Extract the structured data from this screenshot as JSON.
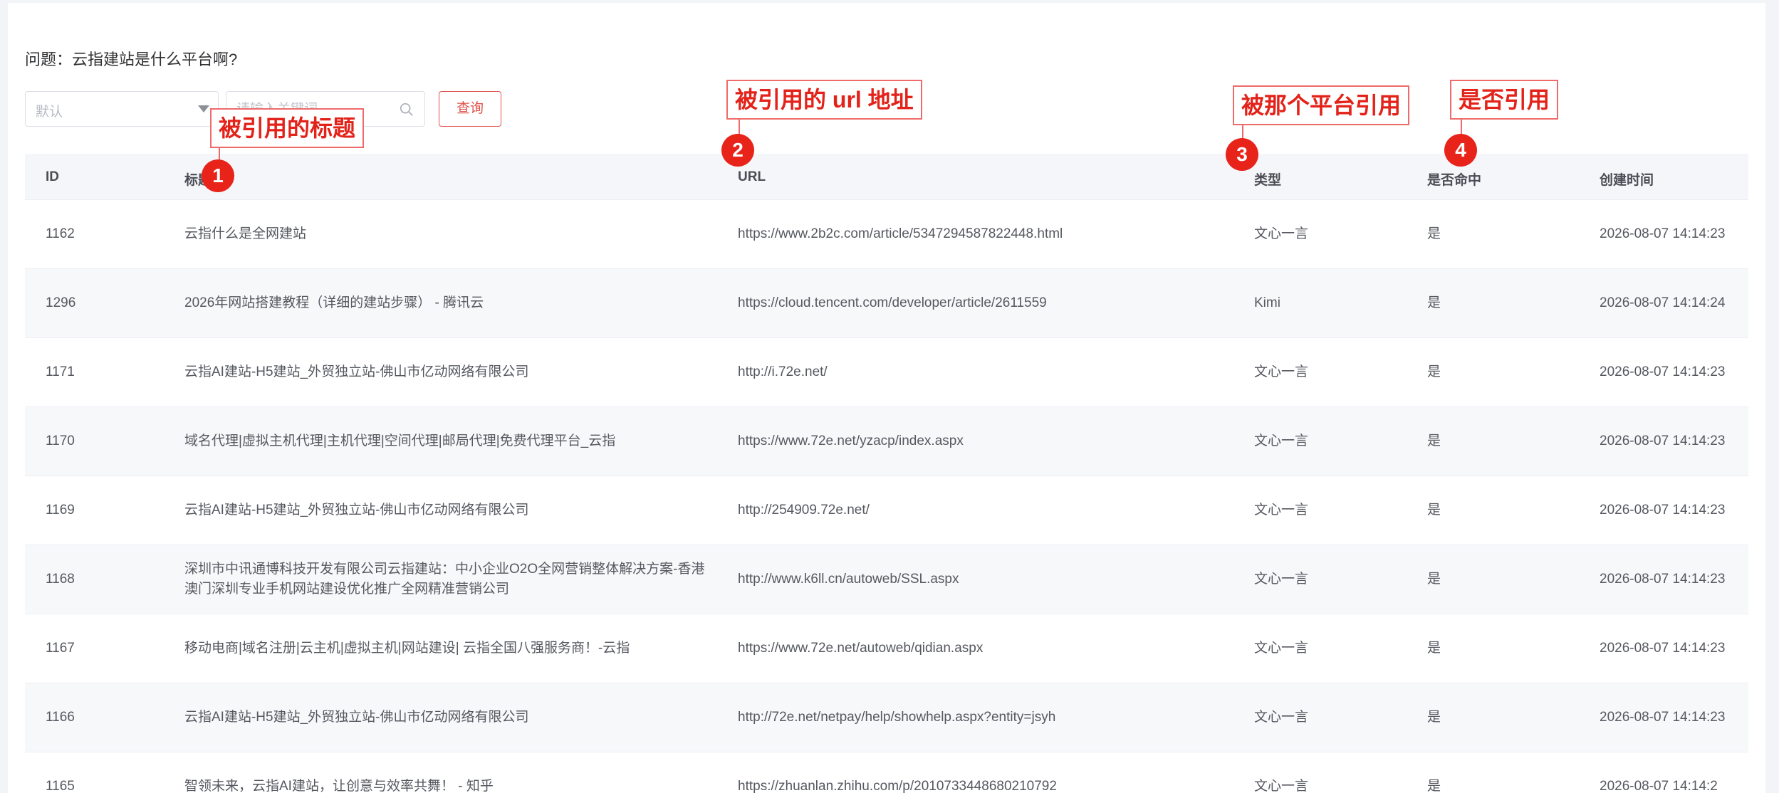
{
  "question": "问题：云指建站是什么平台啊?",
  "filter": {
    "select_value": "默认",
    "search_placeholder": "请输入关键词",
    "query_label": "查询"
  },
  "table": {
    "headers": {
      "id": "ID",
      "title": "标题",
      "url": "URL",
      "type": "类型",
      "hit": "是否命中",
      "time": "创建时间"
    },
    "rows": [
      {
        "id": "1162",
        "title": "云指什么是全网建站",
        "url": "https://www.2b2c.com/article/5347294587822448.html",
        "type": "文心一言",
        "hit": "是",
        "time": "2026-08-07 14:14:23"
      },
      {
        "id": "1296",
        "title": "2026年网站搭建教程（详细的建站步骤） - 腾讯云",
        "url": "https://cloud.tencent.com/developer/article/2611559",
        "type": "Kimi",
        "hit": "是",
        "time": "2026-08-07 14:14:24"
      },
      {
        "id": "1171",
        "title": "云指AI建站-H5建站_外贸独立站-佛山市亿动网络有限公司",
        "url": "http://i.72e.net/",
        "type": "文心一言",
        "hit": "是",
        "time": "2026-08-07 14:14:23"
      },
      {
        "id": "1170",
        "title": "域名代理|虚拟主机代理|主机代理|空间代理|邮局代理|免费代理平台_云指",
        "url": "https://www.72e.net/yzacp/index.aspx",
        "type": "文心一言",
        "hit": "是",
        "time": "2026-08-07 14:14:23"
      },
      {
        "id": "1169",
        "title": "云指AI建站-H5建站_外贸独立站-佛山市亿动网络有限公司",
        "url": "http://254909.72e.net/",
        "type": "文心一言",
        "hit": "是",
        "time": "2026-08-07 14:14:23"
      },
      {
        "id": "1168",
        "title": "深圳市中讯通博科技开发有限公司云指建站：中小企业O2O全网营销整体解决方案-香港澳门深圳专业手机网站建设优化推广全网精准营销公司",
        "url": "http://www.k6ll.cn/autoweb/SSL.aspx",
        "type": "文心一言",
        "hit": "是",
        "time": "2026-08-07 14:14:23"
      },
      {
        "id": "1167",
        "title": "移动电商|域名注册|云主机|虚拟主机|网站建设| 云指全国八强服务商！-云指",
        "url": "https://www.72e.net/autoweb/qidian.aspx",
        "type": "文心一言",
        "hit": "是",
        "time": "2026-08-07 14:14:23"
      },
      {
        "id": "1166",
        "title": "云指AI建站-H5建站_外贸独立站-佛山市亿动网络有限公司",
        "url": "http://72e.net/netpay/help/showhelp.aspx?entity=jsyh",
        "type": "文心一言",
        "hit": "是",
        "time": "2026-08-07 14:14:23"
      },
      {
        "id": "1165",
        "title": "智领未来，云指AI建站，让创意与效率共舞！ - 知乎",
        "url": "https://zhuanlan.zhihu.com/p/2010733448680210792",
        "type": "文心一言",
        "hit": "是",
        "time": "2026-08-07 14:14:2"
      }
    ]
  },
  "annotations": [
    {
      "number": "1",
      "label": "被引用的标题"
    },
    {
      "number": "2",
      "label": "被引用的 url 地址"
    },
    {
      "number": "3",
      "label": "被那个平台引用"
    },
    {
      "number": "4",
      "label": "是否引用"
    }
  ],
  "colors": {
    "accent": "#e0524a",
    "annotation_red": "#e8231a",
    "header_bg": "#f5f6f9"
  }
}
